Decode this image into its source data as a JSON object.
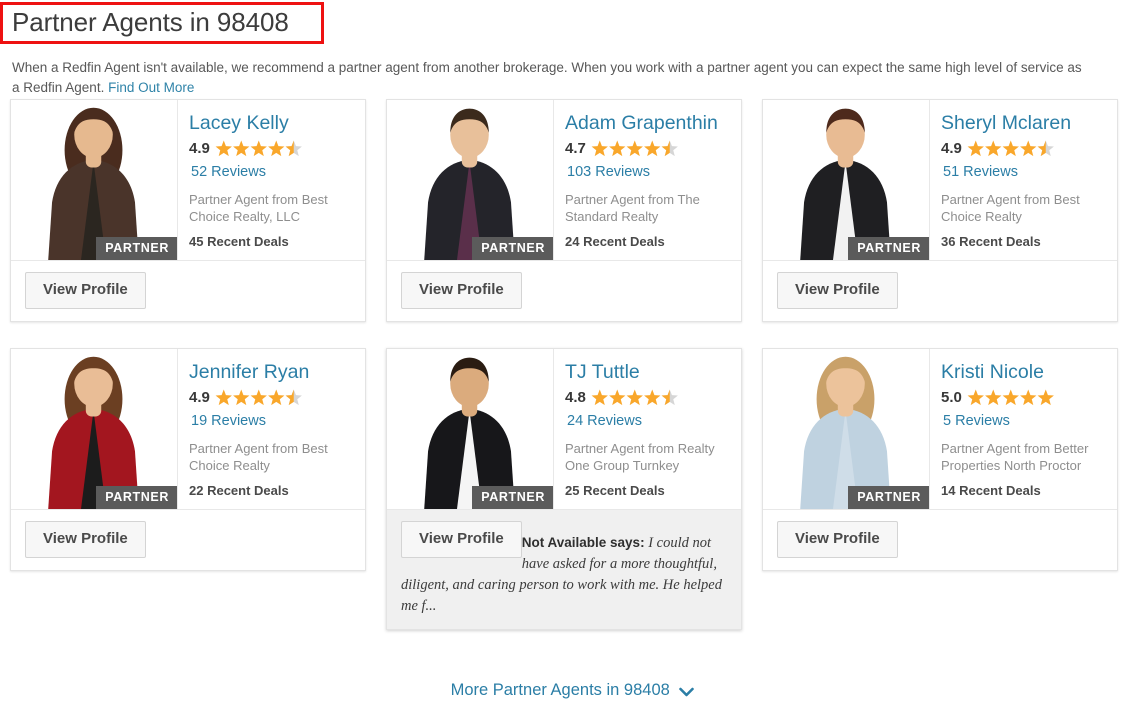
{
  "header": {
    "title": "Partner Agents in 98408",
    "highlight_color": "#ee1111",
    "intro_text": "When a Redfin Agent isn't available, we recommend a partner agent from another brokerage. When you work with a partner agent you can expect the same high level of service as a Redfin Agent. ",
    "intro_link": "Find Out More"
  },
  "theme": {
    "link_color": "#2b7ea6",
    "star_color": "#f9a72b",
    "star_empty_color": "#d6d6d6",
    "badge_color": "#5b5b5b",
    "hover_bg": "#f0f0f0"
  },
  "labels": {
    "partner_badge": "PARTNER",
    "view_profile": "View Profile"
  },
  "agents": [
    {
      "name": "Lacey Kelly",
      "rating": "4.9",
      "stars_full": 4,
      "stars_half": 1,
      "reviews": "52 Reviews",
      "agency": "Partner Agent from Best Choice Realty, LLC",
      "deals": "45 Recent Deals",
      "badge": "PARTNER",
      "button": "View Profile",
      "hovered": false,
      "photo": "woman-brown-cardigan"
    },
    {
      "name": "Adam Grapenthin",
      "rating": "4.7",
      "stars_full": 4,
      "stars_half": 1,
      "reviews": "103 Reviews",
      "agency": "Partner Agent from The Standard Realty",
      "deals": "24 Recent Deals",
      "badge": "PARTNER",
      "button": "View Profile",
      "hovered": false,
      "photo": "man-black-suit-purple-shirt"
    },
    {
      "name": "Sheryl Mclaren",
      "rating": "4.9",
      "stars_full": 4,
      "stars_half": 1,
      "reviews": "51 Reviews",
      "agency": "Partner Agent from Best Choice Realty",
      "deals": "36 Recent Deals",
      "badge": "PARTNER",
      "button": "View Profile",
      "hovered": false,
      "photo": "woman-black-blazer"
    },
    {
      "name": "Jennifer Ryan",
      "rating": "4.9",
      "stars_full": 4,
      "stars_half": 1,
      "reviews": "19 Reviews",
      "agency": "Partner Agent from Best Choice Realty",
      "deals": "22 Recent Deals",
      "badge": "PARTNER",
      "button": "View Profile",
      "hovered": false,
      "photo": "woman-red-jacket"
    },
    {
      "name": "TJ Tuttle",
      "rating": "4.8",
      "stars_full": 4,
      "stars_half": 1,
      "reviews": "24 Reviews",
      "agency": "Partner Agent from Realty One Group Turnkey",
      "deals": "25 Recent Deals",
      "badge": "PARTNER",
      "button": "View Profile",
      "hovered": true,
      "photo": "man-black-suit-white-shirt",
      "quote_author": "Not Available says:",
      "quote_text": " I could not have asked for a more thoughtful, diligent, and caring person to work with me. He helped me f..."
    },
    {
      "name": "Kristi Nicole",
      "rating": "5.0",
      "stars_full": 5,
      "stars_half": 0,
      "reviews": "5 Reviews",
      "agency": "Partner Agent from Better Properties North Proctor",
      "deals": "14 Recent Deals",
      "badge": "PARTNER",
      "button": "View Profile",
      "hovered": false,
      "photo": "woman-light-blue-shirt"
    }
  ],
  "footer": {
    "more_link": "More Partner Agents in 98408",
    "chevron": "chevron-down-icon"
  }
}
